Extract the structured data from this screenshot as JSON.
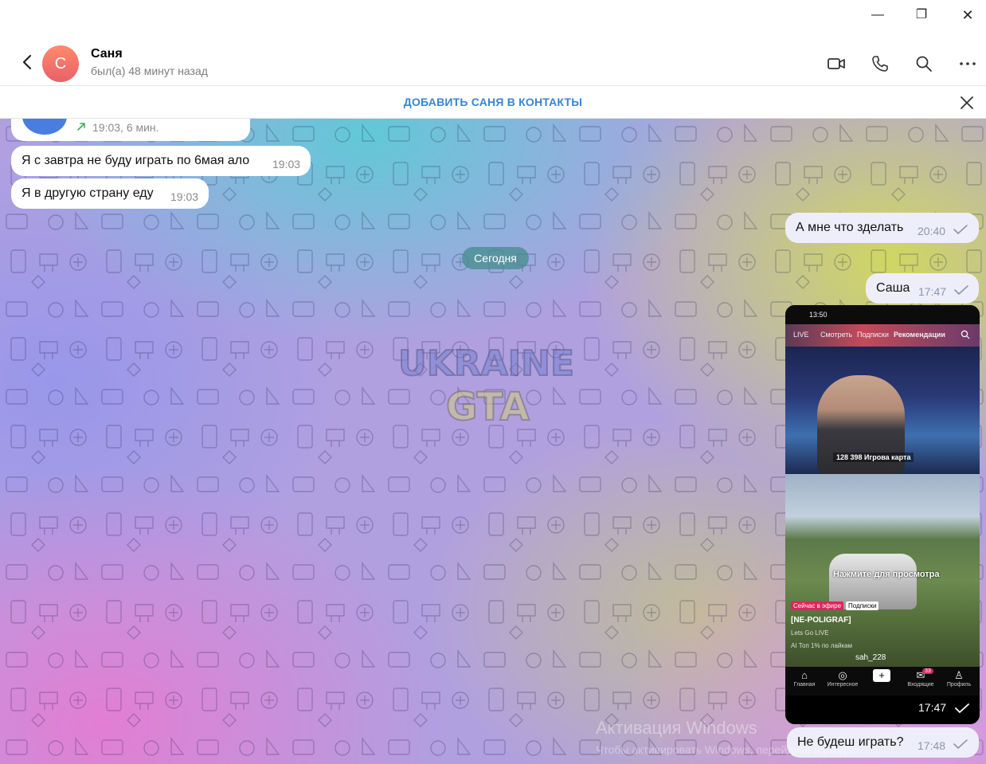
{
  "window": {
    "minimize": "—",
    "maximize": "❐",
    "close": "✕"
  },
  "header": {
    "avatar_letter": "С",
    "name": "Саня",
    "status": "был(а) 48 минут назад",
    "icons": [
      "back-arrow-icon",
      "video-call-icon",
      "phone-icon",
      "search-icon",
      "more-icon"
    ]
  },
  "add_contact": {
    "label": "ДОБАВИТЬ САНЯ В КОНТАКТЫ"
  },
  "messages": {
    "call": {
      "time": "19:03, 6 мин."
    },
    "in1": {
      "text": "Я с завтра не буду играть по 6мая ало",
      "time": "19:03"
    },
    "in2": {
      "text": "Я в другую страну еду",
      "time": "19:03"
    },
    "out1": {
      "text": "А мне что зделать",
      "time": "20:40"
    },
    "date": "Сегодня",
    "out2": {
      "text": "Саша",
      "time": "17:47"
    },
    "media": {
      "time": "17:47",
      "phone_time": "13:50",
      "tabs": [
        "LIVE",
        "Смотреть",
        "Подписки",
        "Рекомендации"
      ],
      "caption_top": "128 398 Игрова карта",
      "overlay": "Нажмите для просмотра",
      "live_label": "Сейчас в эфире",
      "sub_label": "Подписки",
      "channel": "[NE-POLIGRAF]",
      "desc": "Lets Go LIVE",
      "ai": "AI  Топ 1% по лайкам",
      "user": "sah_228",
      "nav": [
        "Главная",
        "Интересное",
        "",
        "Входящие",
        "Профиль"
      ],
      "nav_badge": "33"
    },
    "out3": {
      "text": "Не будеш играть?",
      "time": "17:48"
    }
  },
  "watermark": {
    "activate_title": "Активация Windows",
    "activate_sub": "Чтобы активировать Windows, перейдите в раздел"
  },
  "colors": {
    "accent": "#3a83d6",
    "out_bubble": "#eeeefb",
    "date_pill": "#468c8c"
  }
}
